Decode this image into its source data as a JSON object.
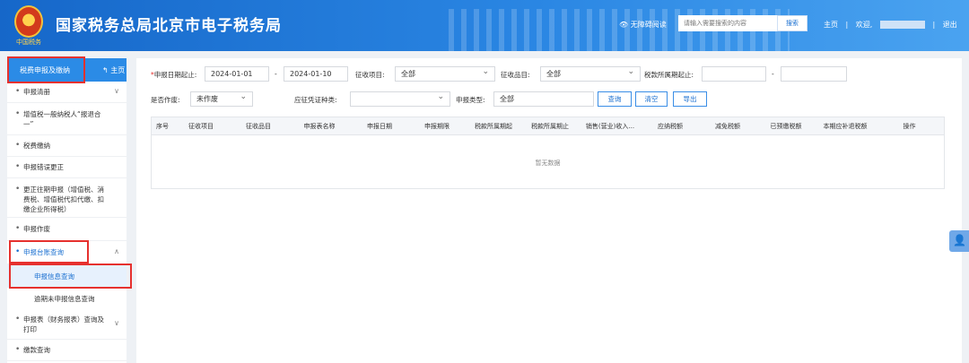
{
  "header": {
    "emblem_text": "中国税务",
    "site_title": "国家税务总局北京市电子税务局",
    "accessibility": "无障碍阅读",
    "search_placeholder": "请输入需要搜索的内容",
    "search_button": "搜索",
    "nav_home": "主页",
    "nav_welcome": "欢迎,",
    "nav_logout": "退出",
    "separator": "|"
  },
  "sidebar": {
    "title": "税费申报及缴纳",
    "home_link": "主页",
    "items": [
      {
        "label": "申报清册"
      },
      {
        "label": "增值税一般纳税人“报退合一”"
      },
      {
        "label": "税费缴纳"
      },
      {
        "label": "申报错误更正"
      },
      {
        "label": "更正往期申报（增值税、消费税、增值税代扣代缴、扣缴企业所得税）"
      },
      {
        "label": "申报作废"
      },
      {
        "label": "申报台账查询"
      },
      {
        "label": "申报表（财务报表）查询及打印"
      },
      {
        "label": "缴款查询"
      }
    ],
    "sub_items": [
      {
        "label": "申报信息查询"
      },
      {
        "label": "逾期未申报信息查询"
      }
    ]
  },
  "filters": {
    "required_mark": "*",
    "date_label": "申报日期起止:",
    "date_start": "2024-01-01",
    "date_sep": "-",
    "date_end": "2024-01-10",
    "levy_item_label": "征收项目:",
    "levy_item_value": "全部",
    "levy_product_label": "征收品目:",
    "levy_product_value": "全部",
    "tax_period_label": "税款所属期起止:",
    "period_sep": "-",
    "void_label": "是否作废:",
    "void_value": "未作废",
    "voucher_label": "应征凭证种类:",
    "voucher_value": "",
    "decl_type_label": "申报类型:",
    "decl_type_value": "全部",
    "query_button": "查询",
    "clear_button": "清空",
    "export_button": "导出"
  },
  "table": {
    "columns": [
      "序号",
      "征收项目",
      "征收品目",
      "申报表名称",
      "申报日期",
      "申报期限",
      "税款所属期起",
      "税款所属期止",
      "销售(营业)收入...",
      "应纳税额",
      "减免税额",
      "已预缴税额",
      "本期应补退税额",
      "操作"
    ],
    "empty_text": "暂无数据"
  },
  "colors": {
    "header_blue": "#1667c9",
    "accent": "#2b8be6",
    "highlight_red": "#e6312e"
  }
}
